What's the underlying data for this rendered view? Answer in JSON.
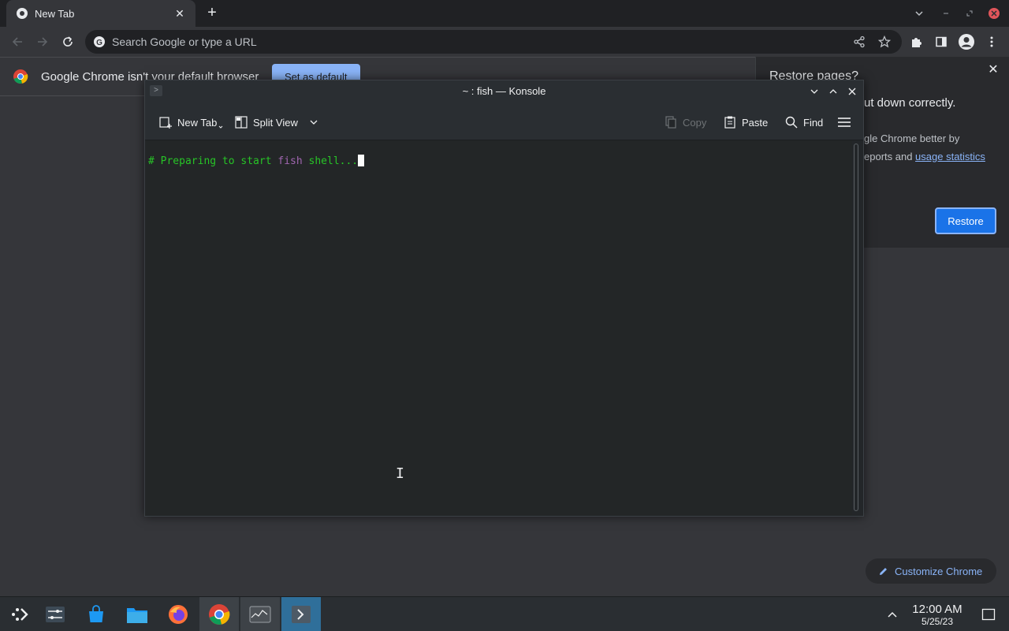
{
  "chrome": {
    "tab": {
      "title": "New Tab"
    },
    "omnibox": {
      "placeholder": "Search Google or type a URL"
    },
    "infobar": {
      "message": "Google Chrome isn't your default browser",
      "button": "Set as default"
    },
    "restore": {
      "title": "Restore pages?",
      "message": "ut down correctly.",
      "line1": "gle Chrome better by",
      "line2_prefix": "eports and ",
      "line2_link": "usage statistics",
      "button": "Restore"
    },
    "customize": {
      "label": "Customize Chrome"
    }
  },
  "konsole": {
    "title": "~ : fish — Konsole",
    "toolbar": {
      "new_tab": "New Tab",
      "split_view": "Split View",
      "copy": "Copy",
      "paste": "Paste",
      "find": "Find"
    },
    "terminal": {
      "prefix": "# Preparing to start ",
      "highlight": "fish",
      "suffix": " shell..."
    }
  },
  "taskbar": {
    "time": "12:00 AM",
    "date": "5/25/23"
  },
  "colors": {
    "accent": "#8ab4f8",
    "restore_button": "#1a73e8",
    "terminal_green": "#27c427",
    "terminal_purple": "#a066b0"
  }
}
